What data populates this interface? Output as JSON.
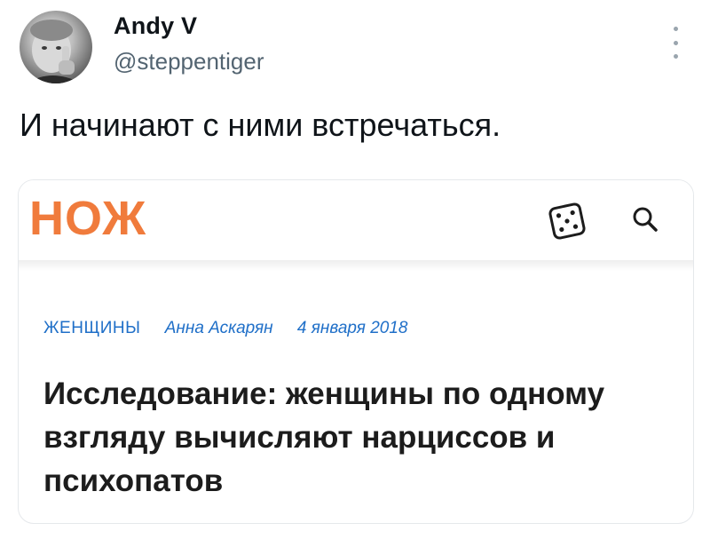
{
  "tweet": {
    "author_name": "Andy V",
    "author_handle": "@steppentiger",
    "text": "И начинают с ними встречаться."
  },
  "card": {
    "logo_text": "НОЖ",
    "logo_color": "#f07b3c",
    "category": "ЖЕНЩИНЫ",
    "author": "Анна Аскарян",
    "date": "4 января 2018",
    "meta_color": "#1f6fc8",
    "headline": "Исследование: женщины по одному взгляду вычисляют нарциссов и психопатов",
    "icons": [
      "dice-icon",
      "search-icon"
    ]
  }
}
